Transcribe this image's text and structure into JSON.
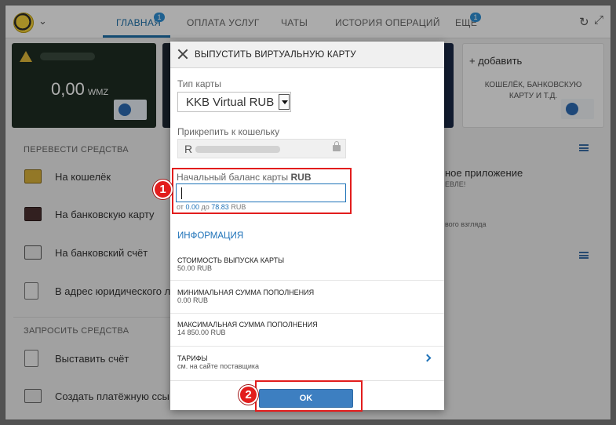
{
  "topbar": {
    "tabs": [
      {
        "label": "ГЛАВНАЯ",
        "badge": "1"
      },
      {
        "label": "ОПЛАТА УСЛУГ"
      },
      {
        "label": "ЧАТЫ"
      },
      {
        "label": "ИСТОРИЯ ОПЕРАЦИЙ"
      },
      {
        "label": "ЕЩЕ",
        "badge": "1"
      }
    ]
  },
  "cards": {
    "first": {
      "amount": "0,00",
      "currency": "WMZ"
    },
    "add": {
      "label": "+ добавить",
      "desc_line1": "КОШЕЛЁК, БАНКОВСКУЮ",
      "desc_line2": "КАРТУ И Т.Д."
    }
  },
  "sidebar": {
    "transfer_title": "ПЕРЕВЕСТИ СРЕДСТВА",
    "transfer_items": [
      "На кошелёк",
      "На банковскую карту",
      "На банковский счёт",
      "В адрес юридического л"
    ],
    "request_title": "ЗАПРОСИТЬ СРЕДСТВА",
    "request_items": [
      "Выставить счёт",
      "Создать платёжную ссы"
    ]
  },
  "right_panel": {
    "app_title": "ное приложение",
    "app_sub": "ЕВЛЕ!",
    "view_text": "вого взгляда"
  },
  "modal": {
    "title": "ВЫПУСТИТЬ ВИРТУАЛЬНУЮ КАРТУ",
    "card_type_label": "Тип карты",
    "card_type_value": "KKB Virtual RUB",
    "wallet_label": "Прикрепить к кошельку",
    "wallet_prefix": "R",
    "balance_label": "Начальный баланс карты",
    "balance_currency": "RUB",
    "range": {
      "from_word": "от",
      "min": "0.00",
      "to_word": "до",
      "max": "78.83",
      "currency": "RUB"
    },
    "info_title": "ИНФОРМАЦИЯ",
    "info": [
      {
        "label": "СТОИМОСТЬ ВЫПУСКА КАРТЫ",
        "value": "50.00 RUB"
      },
      {
        "label": "МИНИМАЛЬНАЯ СУММА ПОПОЛНЕНИЯ",
        "value": "0.00 RUB"
      },
      {
        "label": "МАКСИМАЛЬНАЯ СУММА ПОПОЛНЕНИЯ",
        "value": "14 850.00 RUB"
      },
      {
        "label": "ТАРИФЫ",
        "value": "см. на сайте поставщика"
      }
    ],
    "ok_label": "OK"
  },
  "annotations": {
    "step1": "1",
    "step2": "2"
  },
  "colors": {
    "accent": "#1e72b8",
    "highlight": "#e21d1d",
    "ok_button": "#3d7fc1"
  }
}
